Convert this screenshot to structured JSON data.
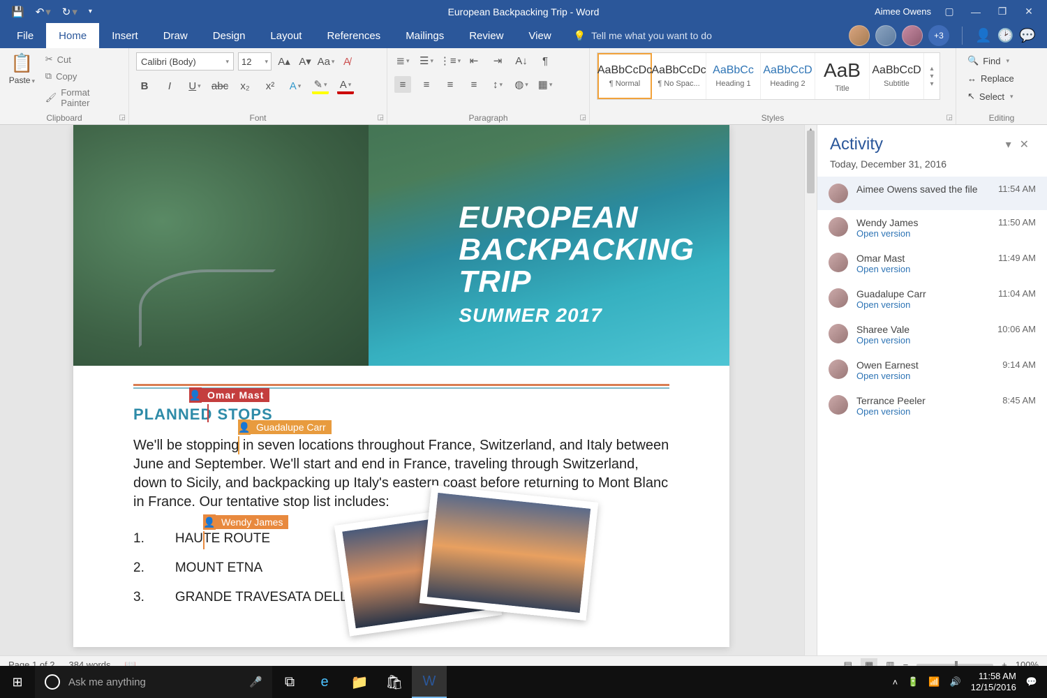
{
  "titlebar": {
    "title": "European Backpacking Trip - Word",
    "user": "Aimee Owens"
  },
  "tabs": [
    "File",
    "Home",
    "Insert",
    "Draw",
    "Design",
    "Layout",
    "References",
    "Mailings",
    "Review",
    "View"
  ],
  "active_tab": "Home",
  "tell_me": "Tell me what you want to do",
  "collab_plus": "+3",
  "clipboard": {
    "paste": "Paste",
    "cut": "Cut",
    "copy": "Copy",
    "format": "Format Painter",
    "label": "Clipboard"
  },
  "font": {
    "name": "Calibri (Body)",
    "size": "12",
    "label": "Font"
  },
  "paragraph_label": "Paragraph",
  "styles": {
    "label": "Styles",
    "items": [
      {
        "preview": "AaBbCcDc",
        "name": "¶ Normal",
        "blue": false,
        "big": false
      },
      {
        "preview": "AaBbCcDc",
        "name": "¶ No Spac...",
        "blue": false,
        "big": false
      },
      {
        "preview": "AaBbCc",
        "name": "Heading 1",
        "blue": true,
        "big": false
      },
      {
        "preview": "AaBbCcD",
        "name": "Heading 2",
        "blue": true,
        "big": false
      },
      {
        "preview": "AaB",
        "name": "Title",
        "blue": false,
        "big": true
      },
      {
        "preview": "AaBbCcD",
        "name": "Subtitle",
        "blue": false,
        "big": false
      }
    ]
  },
  "editing": {
    "find": "Find",
    "replace": "Replace",
    "select": "Select",
    "label": "Editing"
  },
  "hero": {
    "line1": "EUROPEAN",
    "line2": "BACKPACKING",
    "line3": "TRIP",
    "sub": "SUMMER 2017"
  },
  "doc": {
    "section": "PLANNED STOPS",
    "para": "We'll be stopping in seven locations throughout France, Switzerland, and Italy between June and September. We'll start and end in France, traveling through Switzerland, down to Sicily, and backpacking up Italy's eastern coast before returning to Mont Blanc in France. Our tentative stop list includes:",
    "stops": [
      {
        "n": "1.",
        "name": "HAUTE ROUTE"
      },
      {
        "n": "2.",
        "name": "MOUNT ETNA"
      },
      {
        "n": "3.",
        "name": "GRANDE TRAVESATA DELLE ALPI"
      }
    ]
  },
  "presence": {
    "omar": "Omar Mast",
    "guadalupe": "Guadalupe Carr",
    "wendy": "Wendy James"
  },
  "activity": {
    "title": "Activity",
    "date": "Today, December 31, 2016",
    "open": "Open version",
    "items": [
      {
        "text": "Aimee Owens saved the file",
        "time": "11:54 AM",
        "link": false,
        "sel": true
      },
      {
        "text": "Wendy James",
        "time": "11:50 AM",
        "link": true,
        "sel": false
      },
      {
        "text": "Omar Mast",
        "time": "11:49 AM",
        "link": true,
        "sel": false
      },
      {
        "text": "Guadalupe Carr",
        "time": "11:04 AM",
        "link": true,
        "sel": false
      },
      {
        "text": "Sharee Vale",
        "time": "10:06 AM",
        "link": true,
        "sel": false
      },
      {
        "text": "Owen Earnest",
        "time": "9:14 AM",
        "link": true,
        "sel": false
      },
      {
        "text": "Terrance Peeler",
        "time": "8:45 AM",
        "link": true,
        "sel": false
      }
    ]
  },
  "status": {
    "page": "Page 1 of 2",
    "words": "384 words",
    "zoom": "100%"
  },
  "taskbar": {
    "cortana": "Ask me anything",
    "time": "11:58 AM",
    "date": "12/15/2016"
  }
}
